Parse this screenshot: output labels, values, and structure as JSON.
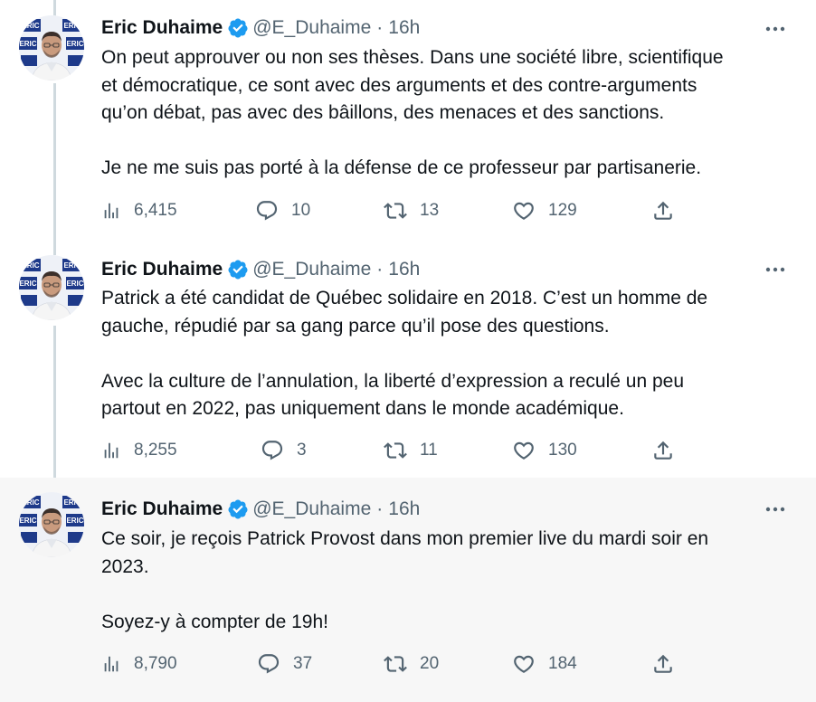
{
  "tweets": [
    {
      "name": "Eric Duhaime",
      "handle": "@E_Duhaime",
      "time": "16h",
      "paragraphs": [
        [
          "On peut approuver ou non ses thèses. Dans une société libre, scientifique",
          "et démocratique, ce sont avec des arguments et des contre-arguments",
          "qu’on débat, pas avec des bâillons, des menaces et des sanctions."
        ],
        [
          "Je ne me suis pas porté à la défense de ce professeur par partisanerie."
        ]
      ],
      "views": "6,415",
      "replies": "10",
      "retweets": "13",
      "likes": "129"
    },
    {
      "name": "Eric Duhaime",
      "handle": "@E_Duhaime",
      "time": "16h",
      "paragraphs": [
        [
          "Patrick a été candidat de Québec solidaire en 2018. C’est un homme de",
          "gauche, répudié par sa gang parce qu’il pose des questions."
        ],
        [
          "Avec la culture de l’annulation, la liberté d’expression a reculé un peu",
          "partout en 2022, pas uniquement dans le monde académique."
        ]
      ],
      "views": "8,255",
      "replies": "3",
      "retweets": "11",
      "likes": "130"
    },
    {
      "name": "Eric Duhaime",
      "handle": "@E_Duhaime",
      "time": "16h",
      "paragraphs": [
        [
          "Ce soir, je reçois Patrick Provost dans mon premier live du mardi soir en",
          "2023."
        ],
        [
          "Soyez-y à compter de 19h!"
        ]
      ],
      "views": "8,790",
      "replies": "37",
      "retweets": "20",
      "likes": "184"
    }
  ],
  "avatar_label": "ERIC",
  "colors": {
    "verified": "#1d9bf0",
    "secondary_text": "#536471",
    "highlight_bg": "#f7f7f7",
    "thread_line": "#cfd9de",
    "avatar_brand": "#1e3a8a"
  },
  "icons": {
    "verified": "verified-badge-icon",
    "more": "more-dots-icon",
    "views": "views-chart-icon",
    "reply": "reply-bubble-icon",
    "retweet": "retweet-icon",
    "like": "heart-icon",
    "share": "share-icon"
  }
}
